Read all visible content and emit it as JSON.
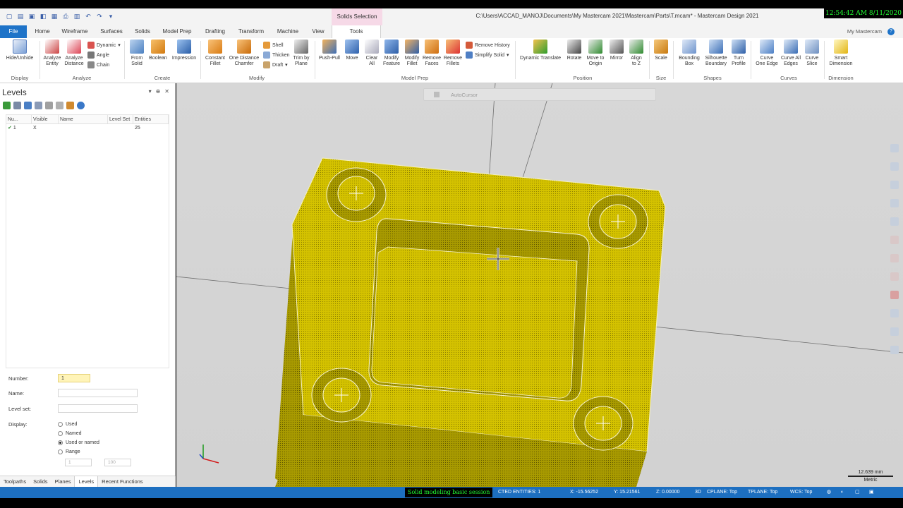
{
  "app": {
    "title": "C:\\Users\\ACCAD_MANOJ\\Documents\\My Mastercam 2021\\Mastercam\\Parts\\T.mcam* - Mastercam Design 2021",
    "context_tab": "Solids Selection",
    "clock": "12:54:42 AM 8/11/2020"
  },
  "menu": {
    "tabs": [
      "File",
      "Home",
      "Wireframe",
      "Surfaces",
      "Solids",
      "Model Prep",
      "Drafting",
      "Transform",
      "Machine",
      "View",
      "Tools"
    ],
    "active": "Tools",
    "account": "My Mastercam"
  },
  "ribbon": {
    "display": {
      "hide_unhide": "Hide/Unhide",
      "group": "Display"
    },
    "analyze": {
      "analyze_entity": "Analyze\nEntity",
      "analyze_distance": "Analyze\nDistance",
      "dynamic": "Dynamic",
      "angle": "Angle",
      "chain": "Chain",
      "group": "Analyze"
    },
    "create": {
      "from_solid": "From\nSolid",
      "boolean": "Boolean",
      "impression": "Impression",
      "group": "Create"
    },
    "modify": {
      "constant_fillet": "Constant\nFillet",
      "one_distance_chamfer": "One Distance\nChamfer",
      "shell": "Shell",
      "thicken": "Thicken",
      "draft": "Draft",
      "trim_by_plane": "Trim by\nPlane",
      "group": "Modify"
    },
    "model_prep": {
      "push_pull": "Push-Pull",
      "move": "Move",
      "clear_all": "Clear\nAll",
      "modify_feature": "Modify\nFeature",
      "modify_fillet": "Modify\nFillet",
      "remove_faces": "Remove\nFaces",
      "remove_fillets": "Remove\nFillets",
      "remove_history": "Remove History",
      "simplify_solid": "Simplify Solid",
      "group": "Model Prep"
    },
    "position": {
      "dynamic_translate": "Dynamic Translate",
      "rotate": "Rotate",
      "move_to_origin": "Move to\nOrigin",
      "mirror": "Mirror",
      "align_to_z": "Align\nto Z",
      "group": "Position"
    },
    "size": {
      "scale": "Scale",
      "group": "Size"
    },
    "shapes": {
      "bounding_box": "Bounding\nBox",
      "silhouette_boundary": "Silhouette\nBoundary",
      "turn_profile": "Turn\nProfile",
      "group": "Shapes"
    },
    "curves": {
      "curve_one_edge": "Curve\nOne Edge",
      "curve_all_edges": "Curve All\nEdges",
      "curve_slice": "Curve\nSlice",
      "group": "Curves"
    },
    "dimension": {
      "smart_dimension": "Smart\nDimension",
      "group": "Dimension"
    }
  },
  "levels_panel": {
    "title": "Levels",
    "columns": [
      "Nu...",
      "Visible",
      "Name",
      "Level Set",
      "Entities"
    ],
    "rows": [
      {
        "number": "1",
        "visible": "X",
        "name": "",
        "level_set": "",
        "entities": "25"
      }
    ],
    "form": {
      "number_label": "Number:",
      "number_value": "1",
      "name_label": "Name:",
      "level_set_label": "Level set:",
      "display_label": "Display:",
      "display_options": [
        "Used",
        "Named",
        "Used or named",
        "Range"
      ],
      "display_selected": "Used or named",
      "range_from": "1",
      "range_to": "100"
    },
    "bottom_tabs": [
      "Toolpaths",
      "Solids",
      "Planes",
      "Levels",
      "Recent Functions"
    ],
    "active_tab": "Levels"
  },
  "viewport": {
    "autocursor_label": "AutoCursor",
    "scale_value": "12.639 mm",
    "scale_unit": "Metric",
    "part_color": "#d4c200"
  },
  "status": {
    "session_banner": "Solid modeling basic session",
    "selected": "CTED ENTITIES: 1",
    "x": "X: -15.56252",
    "y": "Y: 15.21561",
    "z": "Z: 0.00000",
    "mode": "3D",
    "cplane": "CPLANE: Top",
    "tplane": "TPLANE: Top",
    "wcs": "WCS: Top"
  }
}
